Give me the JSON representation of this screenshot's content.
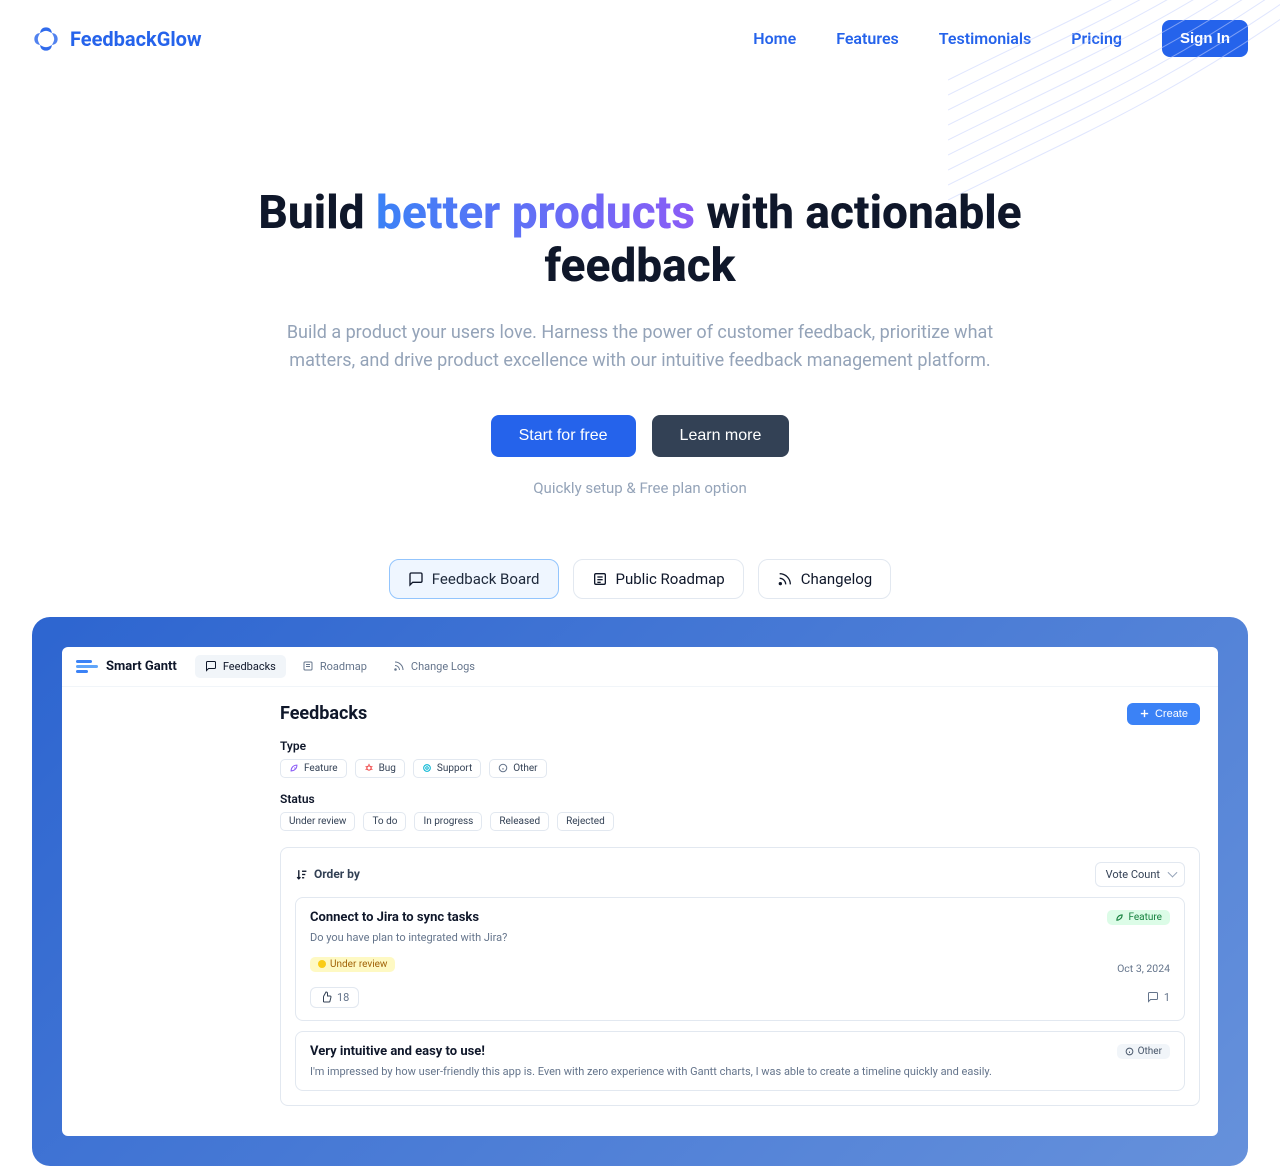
{
  "brand": {
    "name": "FeedbackGlow"
  },
  "nav": {
    "home": "Home",
    "features": "Features",
    "testimonials": "Testimonials",
    "pricing": "Pricing",
    "signin": "Sign In"
  },
  "hero": {
    "h_pre": "Build ",
    "h_highlight": "better products",
    "h_post": " with actionable feedback",
    "sub": "Build a product your users love. Harness the power of customer feedback, prioritize what matters, and drive product excellence with our intuitive feedback management platform.",
    "cta_primary": "Start for free",
    "cta_secondary": "Learn more",
    "tagline": "Quickly setup & Free plan option"
  },
  "tabs": {
    "board": "Feedback Board",
    "roadmap": "Public Roadmap",
    "changelog": "Changelog"
  },
  "app": {
    "product": "Smart Gantt",
    "nav": {
      "feedbacks": "Feedbacks",
      "roadmap": "Roadmap",
      "changelogs": "Change Logs"
    },
    "title": "Feedbacks",
    "create": "Create",
    "type_label": "Type",
    "types": {
      "feature": "Feature",
      "bug": "Bug",
      "support": "Support",
      "other": "Other"
    },
    "status_label": "Status",
    "statuses": {
      "under_review": "Under review",
      "todo": "To do",
      "in_progress": "In progress",
      "released": "Released",
      "rejected": "Rejected"
    },
    "order_by_label": "Order by",
    "order_by_value": "Vote Count",
    "cards": [
      {
        "title": "Connect to Jira to sync tasks",
        "desc": "Do you have plan to integrated with Jira?",
        "type_badge": "Feature",
        "status_badge": "Under review",
        "date": "Oct 3, 2024",
        "votes": "18",
        "comments": "1"
      },
      {
        "title": "Very intuitive and easy to use!",
        "desc": "I'm impressed by how user-friendly this app is. Even with zero experience with Gantt charts, I was able to create a timeline quickly and easily.",
        "type_badge": "Other"
      }
    ]
  }
}
